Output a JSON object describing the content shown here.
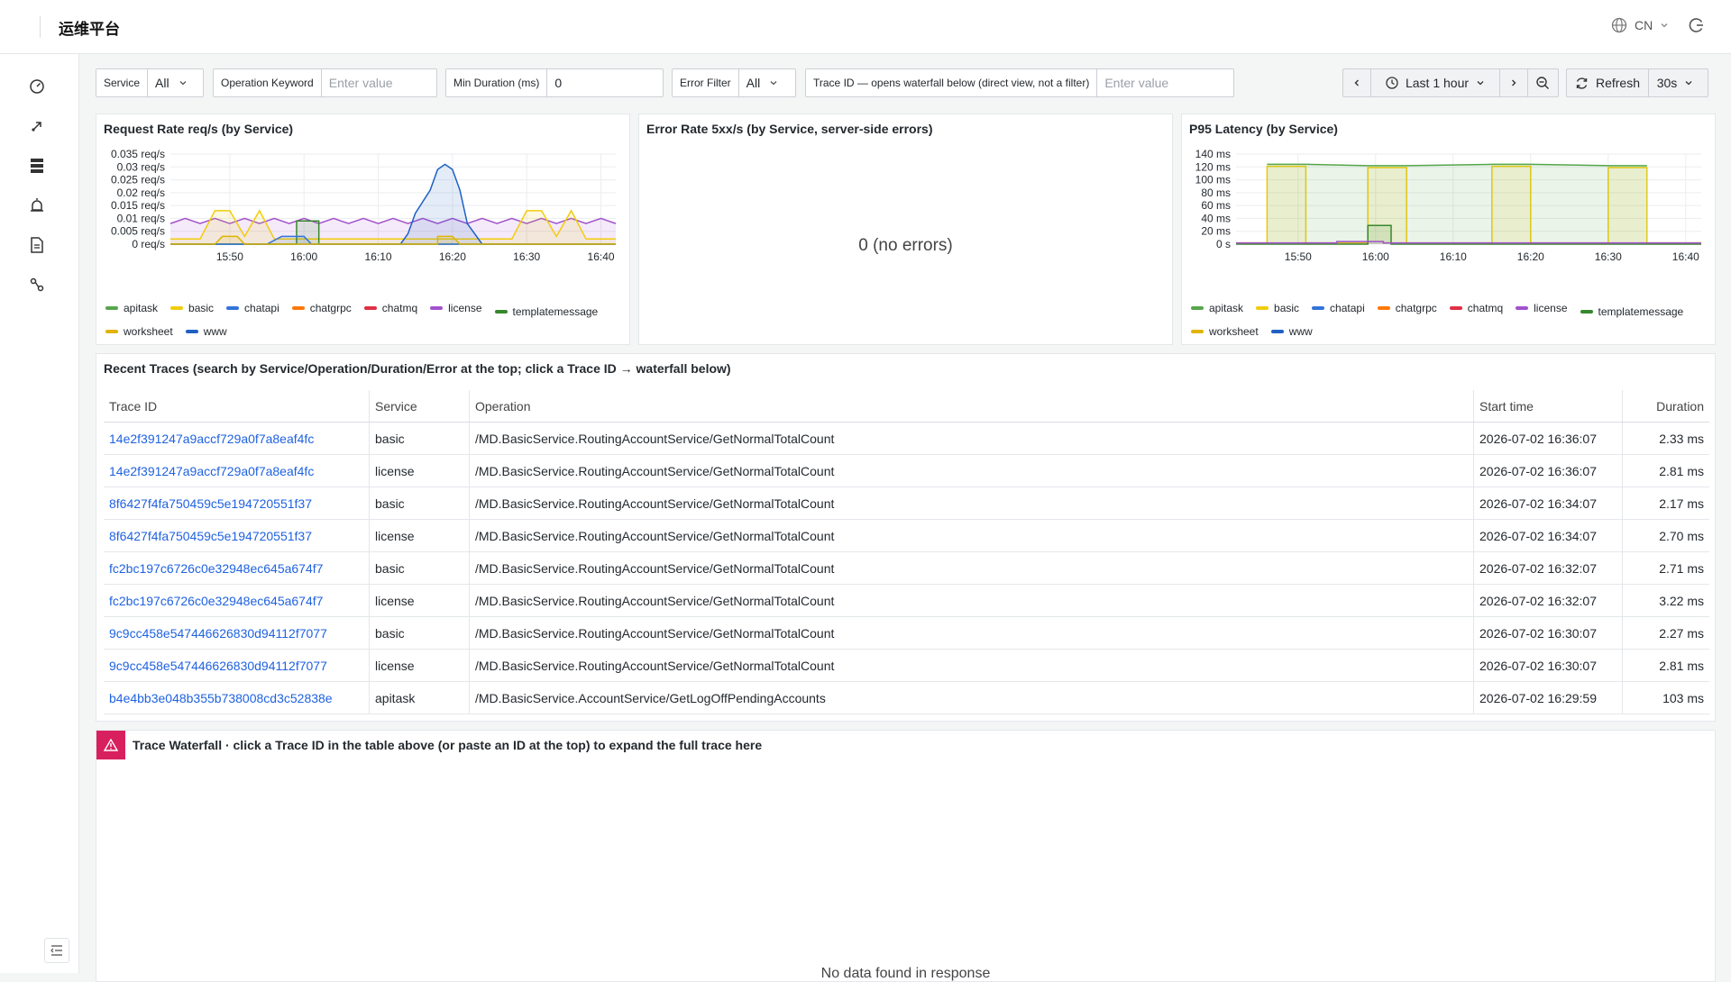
{
  "app": {
    "title": "运维平台",
    "lang": "CN"
  },
  "filters": {
    "service": {
      "label": "Service",
      "value": "All"
    },
    "operation": {
      "label": "Operation Keyword",
      "placeholder": "Enter value"
    },
    "min_duration": {
      "label": "Min Duration (ms)",
      "value": "0"
    },
    "error_filter": {
      "label": "Error Filter",
      "value": "All"
    },
    "trace_id": {
      "label": "Trace ID — opens waterfall below (direct view, not a filter)",
      "placeholder": "Enter value"
    }
  },
  "timepicker": {
    "range": "Last 1 hour",
    "refresh": "Refresh",
    "interval": "30s"
  },
  "panels": {
    "request_rate": {
      "title": "Request Rate req/s (by Service)"
    },
    "error_rate": {
      "title": "Error Rate 5xx/s (by Service, server-side errors)",
      "value": "0 (no errors)"
    },
    "p95": {
      "title": "P95 Latency (by Service)"
    }
  },
  "series_colors": {
    "apitask": "#56a64b",
    "basic": "#f2cc0c",
    "chatapi": "#3274d9",
    "chatgrpc": "#ff780a",
    "chatmq": "#e02f44",
    "license": "#a352cc",
    "templatemessage": "#37872d",
    "worksheet": "#e0b400",
    "www": "#1f60c4"
  },
  "chart_data": [
    {
      "type": "line",
      "title": "Request Rate req/s (by Service)",
      "x_ticks": [
        "15:50",
        "16:00",
        "16:10",
        "16:20",
        "16:30",
        "16:40"
      ],
      "y_ticks": [
        "0 req/s",
        "0.005 req/s",
        "0.01 req/s",
        "0.015 req/s",
        "0.02 req/s",
        "0.025 req/s",
        "0.03 req/s",
        "0.035 req/s"
      ],
      "ylim": [
        0,
        0.035
      ],
      "xlim": [
        "15:42",
        "16:42"
      ],
      "legend": [
        "apitask",
        "basic",
        "chatapi",
        "chatgrpc",
        "chatmq",
        "license",
        "templatemessage",
        "worksheet",
        "www"
      ],
      "legend_position": "bottom",
      "grid": true,
      "series": [
        {
          "name": "license",
          "x": [
            "15:42",
            "15:44",
            "15:46",
            "15:48",
            "15:50",
            "15:52",
            "15:54",
            "15:56",
            "15:58",
            "16:00",
            "16:02",
            "16:04",
            "16:06",
            "16:08",
            "16:10",
            "16:12",
            "16:14",
            "16:16",
            "16:18",
            "16:20",
            "16:22",
            "16:24",
            "16:26",
            "16:28",
            "16:30",
            "16:32",
            "16:34",
            "16:36",
            "16:38",
            "16:40",
            "16:42"
          ],
          "values": [
            0.008,
            0.01,
            0.008,
            0.01,
            0.008,
            0.01,
            0.008,
            0.01,
            0.008,
            0.01,
            0.008,
            0.01,
            0.008,
            0.01,
            0.008,
            0.01,
            0.008,
            0.01,
            0.008,
            0.01,
            0.008,
            0.01,
            0.008,
            0.01,
            0.008,
            0.01,
            0.008,
            0.01,
            0.008,
            0.01,
            0.008
          ]
        },
        {
          "name": "basic",
          "x": [
            "15:42",
            "15:46",
            "15:48",
            "15:50",
            "15:52",
            "15:54",
            "15:56",
            "16:00",
            "16:04",
            "16:08",
            "16:12",
            "16:16",
            "16:20",
            "16:24",
            "16:28",
            "16:30",
            "16:32",
            "16:34",
            "16:36",
            "16:38",
            "16:42"
          ],
          "values": [
            0.002,
            0.002,
            0.013,
            0.013,
            0.003,
            0.013,
            0.002,
            0.002,
            0.002,
            0.002,
            0.002,
            0.002,
            0.002,
            0.002,
            0.002,
            0.013,
            0.013,
            0.003,
            0.013,
            0.002,
            0.002
          ]
        },
        {
          "name": "www",
          "x": [
            "15:42",
            "16:06",
            "16:10",
            "16:13",
            "16:14",
            "16:15",
            "16:17",
            "16:18",
            "16:19",
            "16:20",
            "16:21",
            "16:22",
            "16:24",
            "16:26",
            "16:42"
          ],
          "values": [
            0,
            0,
            0,
            0,
            0.004,
            0.012,
            0.021,
            0.029,
            0.031,
            0.029,
            0.021,
            0.008,
            0,
            0,
            0
          ]
        },
        {
          "name": "templatemessage",
          "x": [
            "15:42",
            "15:59",
            "15:59",
            "16:02",
            "16:02",
            "16:42"
          ],
          "values": [
            0,
            0,
            0.009,
            0.009,
            0,
            0
          ]
        },
        {
          "name": "chatapi",
          "x": [
            "15:42",
            "15:55",
            "15:57",
            "16:00",
            "16:01",
            "16:42"
          ],
          "values": [
            0,
            0,
            0.003,
            0.003,
            0,
            0
          ]
        },
        {
          "name": "worksheet",
          "x": [
            "15:42",
            "15:48",
            "15:49",
            "15:51",
            "15:52",
            "16:18",
            "16:18",
            "16:20",
            "16:21",
            "16:42"
          ],
          "values": [
            0,
            0,
            0.003,
            0.003,
            0,
            0,
            0.003,
            0.003,
            0,
            0
          ]
        }
      ]
    },
    {
      "type": "line",
      "title": "P95 Latency (by Service)",
      "x_ticks": [
        "15:50",
        "16:00",
        "16:10",
        "16:20",
        "16:30",
        "16:40"
      ],
      "y_ticks": [
        "0 s",
        "20 ms",
        "40 ms",
        "60 ms",
        "80 ms",
        "100 ms",
        "120 ms",
        "140 ms"
      ],
      "ylim": [
        0,
        140
      ],
      "xlim": [
        "15:42",
        "16:42"
      ],
      "legend": [
        "apitask",
        "basic",
        "chatapi",
        "chatgrpc",
        "chatmq",
        "license",
        "templatemessage",
        "worksheet",
        "www"
      ],
      "legend_position": "bottom",
      "grid": true,
      "series": [
        {
          "name": "basic",
          "x": [
            "15:42",
            "15:46",
            "15:46",
            "15:51",
            "15:51",
            "15:59",
            "15:59",
            "16:04",
            "16:04",
            "16:15",
            "16:15",
            "16:20",
            "16:20",
            "16:30",
            "16:30",
            "16:35",
            "16:35",
            "16:42"
          ],
          "values": [
            2,
            2,
            121,
            121,
            2,
            2,
            119,
            119,
            2,
            2,
            121,
            121,
            2,
            2,
            119,
            119,
            2,
            2
          ]
        },
        {
          "name": "apitask",
          "x": [
            "15:46",
            "15:51",
            "15:59",
            "16:04",
            "16:15",
            "16:20",
            "16:30",
            "16:35"
          ],
          "values": [
            124,
            124,
            122,
            122,
            124,
            124,
            122,
            122
          ]
        },
        {
          "name": "templatemessage",
          "x": [
            "15:42",
            "15:59",
            "15:59",
            "16:02",
            "16:02",
            "16:42"
          ],
          "values": [
            0,
            0,
            29,
            29,
            0,
            0
          ]
        },
        {
          "name": "license",
          "x": [
            "15:42",
            "15:55",
            "15:55",
            "16:01",
            "16:01",
            "16:42"
          ],
          "values": [
            2,
            2,
            4,
            4,
            2,
            2
          ]
        }
      ]
    }
  ],
  "table": {
    "title": "Recent Traces (search by Service/Operation/Duration/Error at the top; click a Trace ID → waterfall below)",
    "columns": [
      "Trace ID",
      "Service",
      "Operation",
      "Start time",
      "Duration"
    ],
    "rows": [
      [
        "14e2f391247a9accf729a0f7a8eaf4fc",
        "basic",
        "/MD.BasicService.RoutingAccountService/GetNormalTotalCount",
        "2026-07-02 16:36:07",
        "2.33 ms"
      ],
      [
        "14e2f391247a9accf729a0f7a8eaf4fc",
        "license",
        "/MD.BasicService.RoutingAccountService/GetNormalTotalCount",
        "2026-07-02 16:36:07",
        "2.81 ms"
      ],
      [
        "8f6427f4fa750459c5e194720551f37",
        "basic",
        "/MD.BasicService.RoutingAccountService/GetNormalTotalCount",
        "2026-07-02 16:34:07",
        "2.17 ms"
      ],
      [
        "8f6427f4fa750459c5e194720551f37",
        "license",
        "/MD.BasicService.RoutingAccountService/GetNormalTotalCount",
        "2026-07-02 16:34:07",
        "2.70 ms"
      ],
      [
        "fc2bc197c6726c0e32948ec645a674f7",
        "basic",
        "/MD.BasicService.RoutingAccountService/GetNormalTotalCount",
        "2026-07-02 16:32:07",
        "2.71 ms"
      ],
      [
        "fc2bc197c6726c0e32948ec645a674f7",
        "license",
        "/MD.BasicService.RoutingAccountService/GetNormalTotalCount",
        "2026-07-02 16:32:07",
        "3.22 ms"
      ],
      [
        "9c9cc458e547446626830d94112f7077",
        "basic",
        "/MD.BasicService.RoutingAccountService/GetNormalTotalCount",
        "2026-07-02 16:30:07",
        "2.27 ms"
      ],
      [
        "9c9cc458e547446626830d94112f7077",
        "license",
        "/MD.BasicService.RoutingAccountService/GetNormalTotalCount",
        "2026-07-02 16:30:07",
        "2.81 ms"
      ],
      [
        "b4e4bb3e048b355b738008cd3c52838e",
        "apitask",
        "/MD.BasicService.AccountService/GetLogOffPendingAccounts",
        "2026-07-02 16:29:59",
        "103 ms"
      ]
    ]
  },
  "waterfall": {
    "title": "Trace Waterfall · click a Trace ID in the table above (or paste an ID at the top) to expand the full trace here",
    "empty": "No data found in response"
  }
}
